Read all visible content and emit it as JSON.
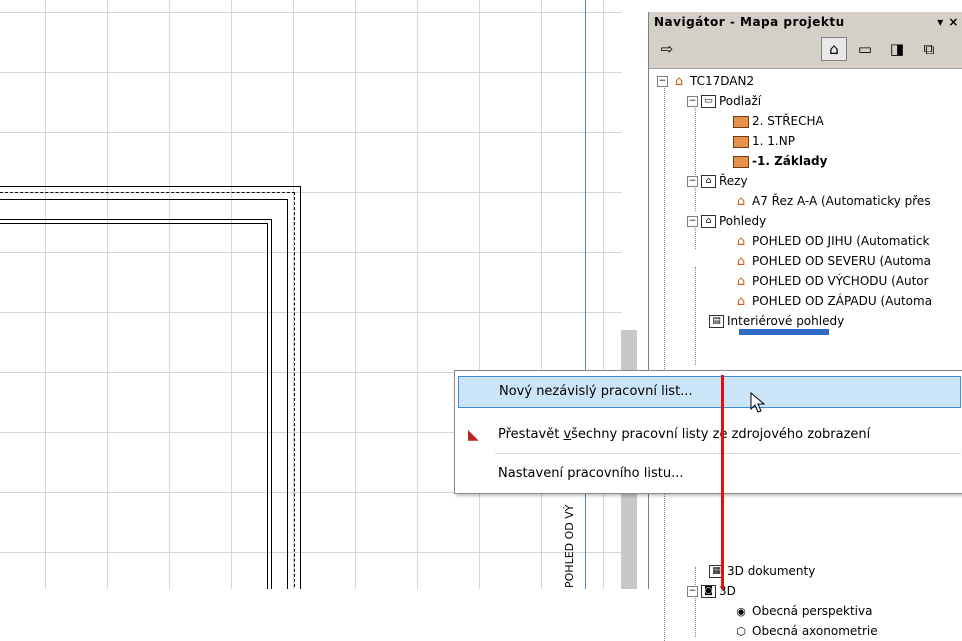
{
  "canvas": {
    "vertical_label": "POHLED OD VÝ"
  },
  "navigator": {
    "title": "Navigátor - Mapa projektu",
    "title_controls": "▾ ×",
    "tree": [
      {
        "label": "TC17DAN2"
      },
      {
        "label": "Podlaží"
      },
      {
        "label": "2. STŘECHA"
      },
      {
        "label": "1. 1.NP"
      },
      {
        "label": "-1. Základy"
      },
      {
        "label": "Řezy"
      },
      {
        "label": "A7 Řez A-A (Automaticky přes"
      },
      {
        "label": "Pohledy"
      },
      {
        "label": "POHLED OD JIHU (Automatick"
      },
      {
        "label": "POHLED OD SEVERU (Automa"
      },
      {
        "label": "POHLED OD VÝCHODU (Autor"
      },
      {
        "label": "POHLED OD ZÁPADU (Automa"
      },
      {
        "label": "Interiérové pohledy"
      },
      {
        "label": "3D dokumenty"
      },
      {
        "label": "3D"
      },
      {
        "label": "Obecná perspektiva"
      },
      {
        "label": "Obecná axonometrie"
      }
    ]
  },
  "context_menu": {
    "item1": "Nový nezávislý pracovní list...",
    "item2_pre": "Přestavět ",
    "item2_ul": "v",
    "item2_post": "šechny pracovní listy ze zdrojového zobrazení",
    "item3": "Nastavení pracovního listu..."
  },
  "colors": {
    "menu_highlight": "#cce4f7",
    "menu_highlight_border": "#3c8ed8",
    "annotation_line": "#e01010",
    "section_line": "#3a8fd8"
  }
}
